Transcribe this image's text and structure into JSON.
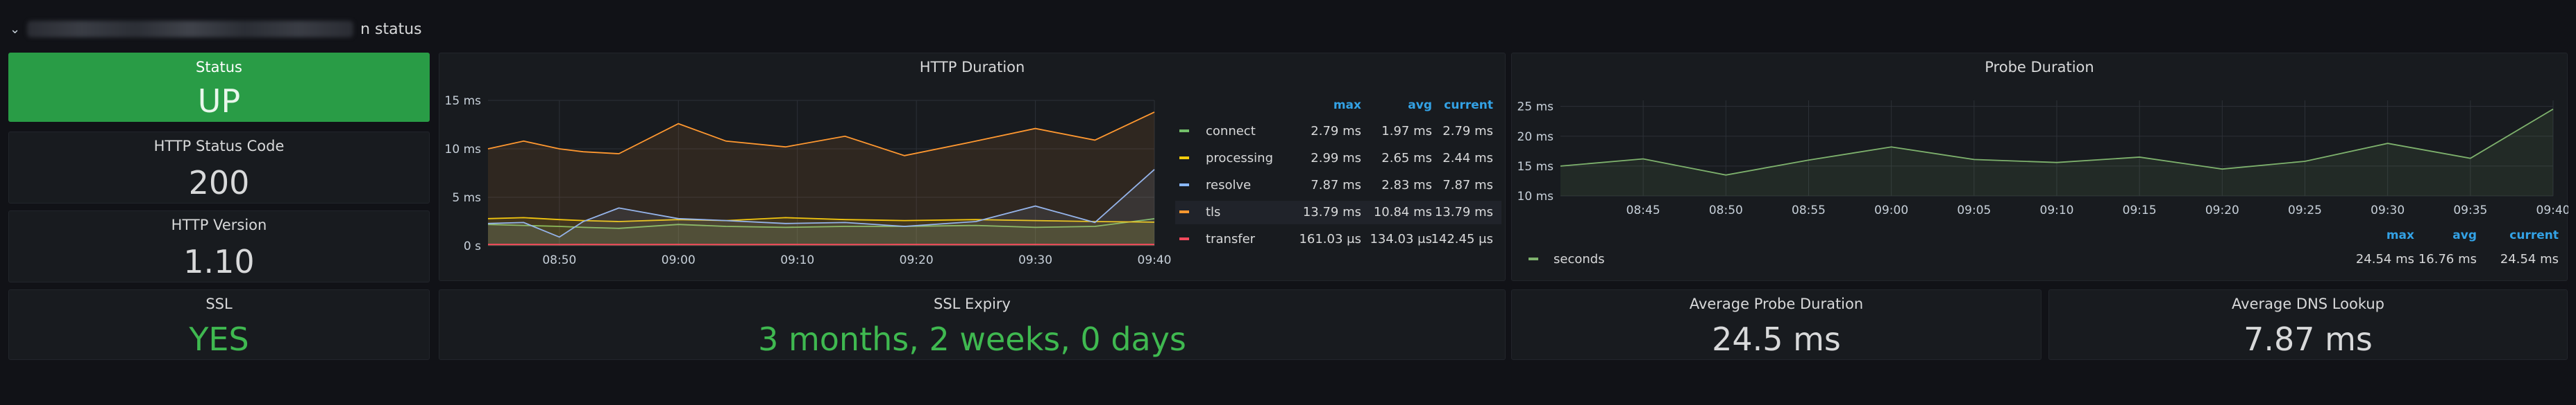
{
  "header": {
    "title_suffix": "n status"
  },
  "panels": {
    "status": {
      "title": "Status",
      "value": "UP"
    },
    "http_status_code": {
      "title": "HTTP Status Code",
      "value": "200"
    },
    "http_version": {
      "title": "HTTP Version",
      "value": "1.10"
    },
    "ssl": {
      "title": "SSL",
      "value": "YES"
    },
    "ssl_expiry": {
      "title": "SSL Expiry",
      "value": "3 months, 2 weeks, 0 days"
    },
    "avg_probe": {
      "title": "Average Probe Duration",
      "value": "24.5 ms"
    },
    "avg_dns": {
      "title": "Average DNS Lookup",
      "value": "7.87 ms"
    },
    "http_duration": {
      "title": "HTTP Duration"
    },
    "probe_duration": {
      "title": "Probe Duration"
    }
  },
  "colors": {
    "green": "#299c46",
    "green_text": "#3fb950",
    "connect": "#73bf69",
    "processing": "#f2cc0c",
    "resolve": "#8ab8ff",
    "tls": "#ff9830",
    "transfer": "#f2495c",
    "seconds": "#7eb26d"
  },
  "chart_data": [
    {
      "type": "area",
      "title": "HTTP Duration",
      "x": [
        "08:44",
        "08:47",
        "08:50",
        "08:52",
        "08:55",
        "09:00",
        "09:04",
        "09:09",
        "09:14",
        "09:19",
        "09:25",
        "09:30",
        "09:35",
        "09:40"
      ],
      "x_tick_labels": [
        "08:50",
        "09:00",
        "09:10",
        "09:20",
        "09:30",
        "09:40"
      ],
      "y_tick_labels": [
        "0 s",
        "5 ms",
        "10 ms",
        "15 ms"
      ],
      "ylim": [
        0,
        15
      ],
      "legend_headers": [
        "max",
        "avg",
        "current"
      ],
      "series": [
        {
          "name": "connect",
          "max": "2.79 ms",
          "avg": "1.97 ms",
          "current": "2.79 ms",
          "values": [
            2.2,
            2.1,
            2.0,
            1.9,
            1.8,
            2.2,
            2.0,
            1.9,
            2.0,
            2.0,
            2.1,
            1.9,
            2.0,
            2.79
          ]
        },
        {
          "name": "processing",
          "max": "2.99 ms",
          "avg": "2.65 ms",
          "current": "2.44 ms",
          "values": [
            2.8,
            2.9,
            2.7,
            2.6,
            2.5,
            2.7,
            2.6,
            2.9,
            2.7,
            2.6,
            2.7,
            2.6,
            2.5,
            2.44
          ]
        },
        {
          "name": "resolve",
          "max": "7.87 ms",
          "avg": "2.83 ms",
          "current": "7.87 ms",
          "values": [
            2.3,
            2.4,
            0.9,
            2.5,
            3.9,
            2.8,
            2.6,
            2.3,
            2.4,
            2.0,
            2.5,
            4.1,
            2.4,
            7.87
          ]
        },
        {
          "name": "tls",
          "max": "13.79 ms",
          "avg": "10.84 ms",
          "current": "13.79 ms",
          "values": [
            10.0,
            10.8,
            10.0,
            9.7,
            9.5,
            12.6,
            10.8,
            10.2,
            11.3,
            9.3,
            10.8,
            12.1,
            10.9,
            13.79
          ]
        },
        {
          "name": "transfer",
          "max": "161.03 μs",
          "avg": "134.03 μs",
          "current": "142.45 μs",
          "values": [
            0.14,
            0.14,
            0.13,
            0.14,
            0.13,
            0.14,
            0.13,
            0.14,
            0.13,
            0.14,
            0.13,
            0.14,
            0.13,
            0.14
          ]
        }
      ]
    },
    {
      "type": "area",
      "title": "Probe Duration",
      "x": [
        "08:40",
        "08:45",
        "08:50",
        "08:55",
        "09:00",
        "09:05",
        "09:10",
        "09:15",
        "09:20",
        "09:25",
        "09:30",
        "09:35",
        "09:40"
      ],
      "x_tick_labels": [
        "08:45",
        "08:50",
        "08:55",
        "09:00",
        "09:05",
        "09:10",
        "09:15",
        "09:20",
        "09:25",
        "09:30",
        "09:35",
        "09:40"
      ],
      "y_tick_labels": [
        "10 ms",
        "15 ms",
        "20 ms",
        "25 ms"
      ],
      "ylim": [
        10,
        26
      ],
      "legend_headers": [
        "max",
        "avg",
        "current"
      ],
      "series": [
        {
          "name": "seconds",
          "max": "24.54 ms",
          "avg": "16.76 ms",
          "current": "24.54 ms",
          "values": [
            15.0,
            16.2,
            13.5,
            16.0,
            18.2,
            16.1,
            15.6,
            16.5,
            14.5,
            15.8,
            18.8,
            16.3,
            24.54
          ]
        }
      ]
    }
  ]
}
